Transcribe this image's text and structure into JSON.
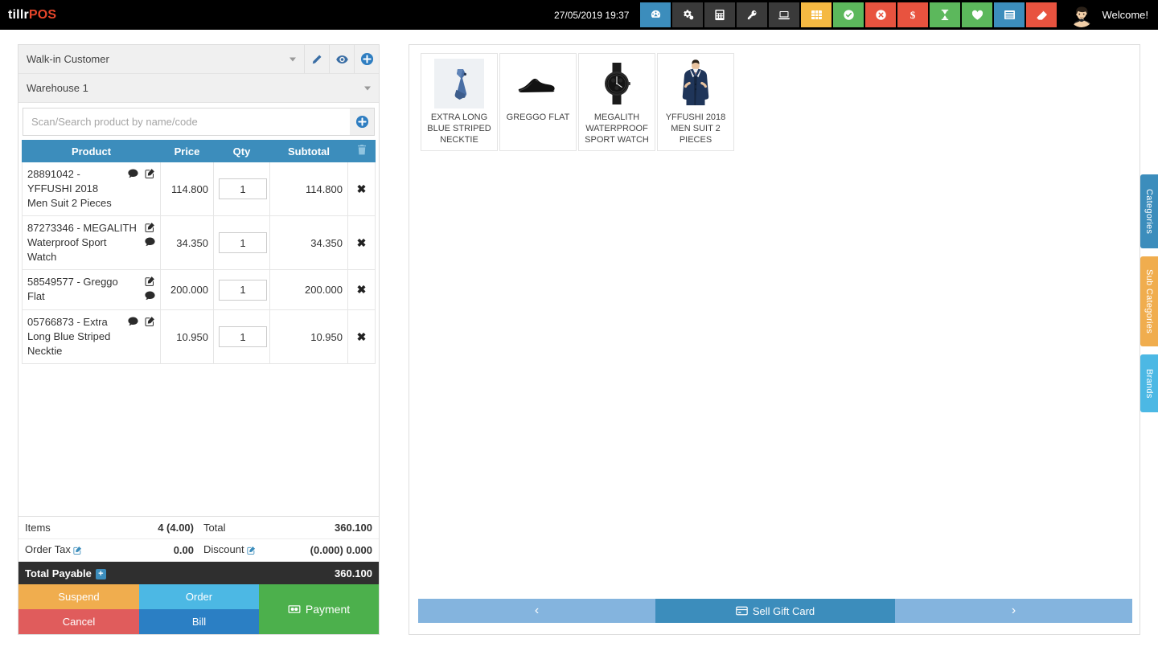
{
  "topbar": {
    "brand_part1": "tillr",
    "brand_part2": "POS",
    "datetime": "27/05/2019 19:37",
    "welcome": "Welcome!",
    "icons": [
      {
        "name": "dashboard-icon",
        "glyph": "gauge",
        "bg": "#3c8dbc"
      },
      {
        "name": "cogs-icon",
        "glyph": "cogs",
        "bg": "#3a3a3a"
      },
      {
        "name": "calculator-icon",
        "glyph": "calculator",
        "bg": "#3a3a3a"
      },
      {
        "name": "key-icon",
        "glyph": "key",
        "bg": "#3a3a3a"
      },
      {
        "name": "laptop-icon",
        "glyph": "laptop",
        "bg": "#3a3a3a"
      },
      {
        "name": "grid-icon",
        "glyph": "grid",
        "bg": "#f5b942"
      },
      {
        "name": "check-circle-icon",
        "glyph": "check-circle",
        "bg": "#5cb85c"
      },
      {
        "name": "times-circle-icon",
        "glyph": "times-circle",
        "bg": "#e8533f"
      },
      {
        "name": "dollar-icon",
        "glyph": "dollar",
        "bg": "#e8533f"
      },
      {
        "name": "hourglass-icon",
        "glyph": "hourglass",
        "bg": "#5cb85c"
      },
      {
        "name": "heart-icon",
        "glyph": "heart",
        "bg": "#5cb85c"
      },
      {
        "name": "list-icon",
        "glyph": "list",
        "bg": "#3c8dbc"
      },
      {
        "name": "eraser-icon",
        "glyph": "eraser",
        "bg": "#e8533f"
      }
    ]
  },
  "left": {
    "customer": "Walk-in Customer",
    "warehouse": "Warehouse 1",
    "search_placeholder": "Scan/Search product by name/code",
    "search_value": "",
    "table_headers": {
      "product": "Product",
      "price": "Price",
      "qty": "Qty",
      "subtotal": "Subtotal"
    },
    "rows": [
      {
        "code": "28891042",
        "name": "YFFUSHI 2018 Men Suit 2 Pieces",
        "label": "28891042 - YFFUSHI 2018 Men Suit 2 Pieces",
        "price": "114.800",
        "qty": "1",
        "subtotal": "114.800"
      },
      {
        "code": "87273346",
        "name": "MEGALITH Waterproof Sport Watch",
        "label": "87273346 - MEGALITH Waterproof Sport Watch",
        "price": "34.350",
        "qty": "1",
        "subtotal": "34.350"
      },
      {
        "code": "58549577",
        "name": "Greggo Flat",
        "label": "58549577 - Greggo Flat",
        "price": "200.000",
        "qty": "1",
        "subtotal": "200.000"
      },
      {
        "code": "05766873",
        "name": "Extra Long Blue Striped Necktie",
        "label": "05766873 - Extra Long Blue Striped Necktie",
        "price": "10.950",
        "qty": "1",
        "subtotal": "10.950"
      }
    ],
    "totals": {
      "items_label": "Items",
      "items_value": "4 (4.00)",
      "total_label": "Total",
      "total_value": "360.100",
      "tax_label": "Order Tax",
      "tax_value": "0.00",
      "discount_label": "Discount",
      "discount_value": "(0.000) 0.000",
      "payable_label": "Total Payable",
      "payable_value": "360.100"
    },
    "buttons": {
      "suspend": "Suspend",
      "cancel": "Cancel",
      "order": "Order",
      "bill": "Bill",
      "payment": "Payment"
    }
  },
  "right": {
    "products": [
      {
        "name": "EXTRA LONG BLUE STRIPED NECKTIE",
        "image": "necktie"
      },
      {
        "name": "GREGGO FLAT",
        "image": "shoe"
      },
      {
        "name": "MEGALITH WATERPROOF SPORT WATCH",
        "image": "watch"
      },
      {
        "name": "YFFUSHI 2018 MEN SUIT 2 PIECES",
        "image": "suit"
      }
    ],
    "side_tabs": [
      {
        "label": "Categories",
        "color": "#3c8dbc"
      },
      {
        "label": "Sub Categories",
        "color": "#f0ad4e"
      },
      {
        "label": "Brands",
        "color": "#4cb8e4"
      }
    ],
    "bottom_nav": {
      "prev": "‹",
      "gift_card": "Sell Gift Card",
      "next": "›"
    }
  }
}
